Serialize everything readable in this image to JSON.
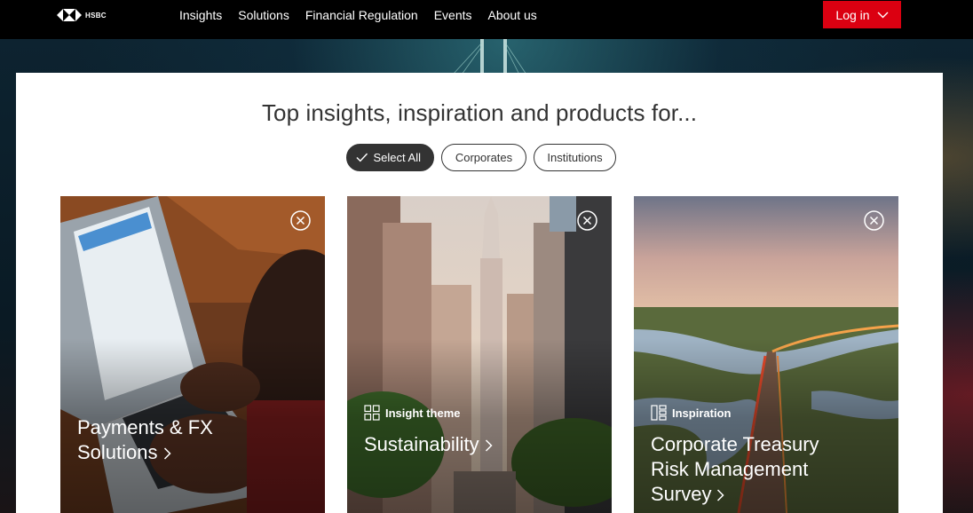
{
  "brand": {
    "logo_text": "HSBC",
    "accent": "#db0011"
  },
  "nav": {
    "items": [
      "Insights",
      "Solutions",
      "Financial Regulation",
      "Events",
      "About us"
    ],
    "login_label": "Log in"
  },
  "panel": {
    "headline": "Top insights, inspiration and products for...",
    "filters": [
      {
        "label": "Select All",
        "selected": true
      },
      {
        "label": "Corporates",
        "selected": false
      },
      {
        "label": "Institutions",
        "selected": false
      }
    ]
  },
  "cards": [
    {
      "tag": "",
      "tag_icon": "",
      "title_line1": "Payments & FX",
      "title_line2": "Solutions",
      "image": "person-typing-on-laptop"
    },
    {
      "tag": "Insight theme",
      "tag_icon": "grid-icon",
      "title_line1": "Sustainability",
      "title_line2": "",
      "image": "city-street-skyscrapers"
    },
    {
      "tag": "Inspiration",
      "tag_icon": "layout-icon",
      "title_line1": "Corporate Treasury",
      "title_line2": "Risk Management",
      "title_line3": "Survey",
      "image": "road-through-wetlands"
    }
  ]
}
